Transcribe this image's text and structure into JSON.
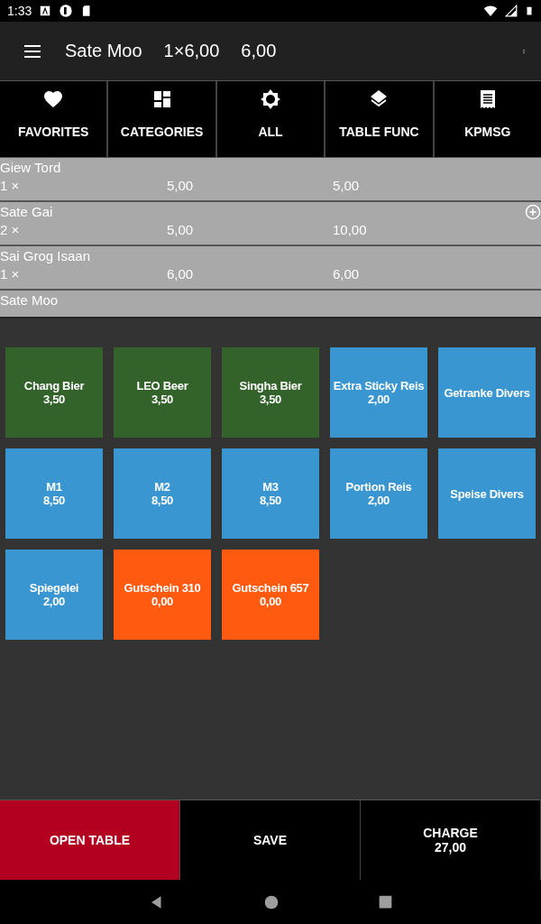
{
  "status_bar": {
    "time": "1:33"
  },
  "app_bar": {
    "item": "Sate Moo",
    "qty_price": "1×6,00",
    "total": "6,00"
  },
  "tabs": [
    {
      "label": "FAVORITES"
    },
    {
      "label": "CATEGORIES"
    },
    {
      "label": "ALL"
    },
    {
      "label": "TABLE FUNC"
    },
    {
      "label": "KPMSG"
    }
  ],
  "order_lines": [
    {
      "name": "Giew Tord",
      "qty": "1 ×",
      "price": "5,00",
      "total": "5,00",
      "add_icon": false
    },
    {
      "name": "Sate Gai",
      "qty": "2 ×",
      "price": "5,00",
      "total": "10,00",
      "add_icon": true
    },
    {
      "name": "Sai Grog Isaan",
      "qty": "1 ×",
      "price": "6,00",
      "total": "6,00",
      "add_icon": false
    },
    {
      "name": "Sate Moo",
      "add_icon": false
    }
  ],
  "products": [
    {
      "name": "Chang Bier",
      "price": "3,50",
      "color": "#33632a"
    },
    {
      "name": "LEO Beer",
      "price": "3,50",
      "color": "#33632a"
    },
    {
      "name": "Singha Bier",
      "price": "3,50",
      "color": "#33632a"
    },
    {
      "name": "Extra Sticky Reis",
      "price": "2,00",
      "color": "#3a96d0"
    },
    {
      "name": "Getranke Divers",
      "color": "#3a96d0"
    },
    {
      "name": "M1",
      "price": "8,50",
      "color": "#3a96d0"
    },
    {
      "name": "M2",
      "price": "8,50",
      "color": "#3a96d0"
    },
    {
      "name": "M3",
      "price": "8,50",
      "color": "#3a96d0"
    },
    {
      "name": "Portion Reis",
      "price": "2,00",
      "color": "#3a96d0"
    },
    {
      "name": "Speise Divers",
      "color": "#3a96d0"
    },
    {
      "name": "Spiegelei",
      "price": "2,00",
      "color": "#3a96d0"
    },
    {
      "name": "Gutschein 310",
      "price": "0,00",
      "color": "#ff5a0f"
    },
    {
      "name": "Gutschein 657",
      "price": "0,00",
      "color": "#ff5a0f"
    }
  ],
  "actions": [
    {
      "label": "OPEN TABLE",
      "kind": "danger"
    },
    {
      "label": "SAVE",
      "kind": "plain"
    },
    {
      "label": "CHARGE",
      "amount": "27,00",
      "kind": "plain"
    }
  ]
}
